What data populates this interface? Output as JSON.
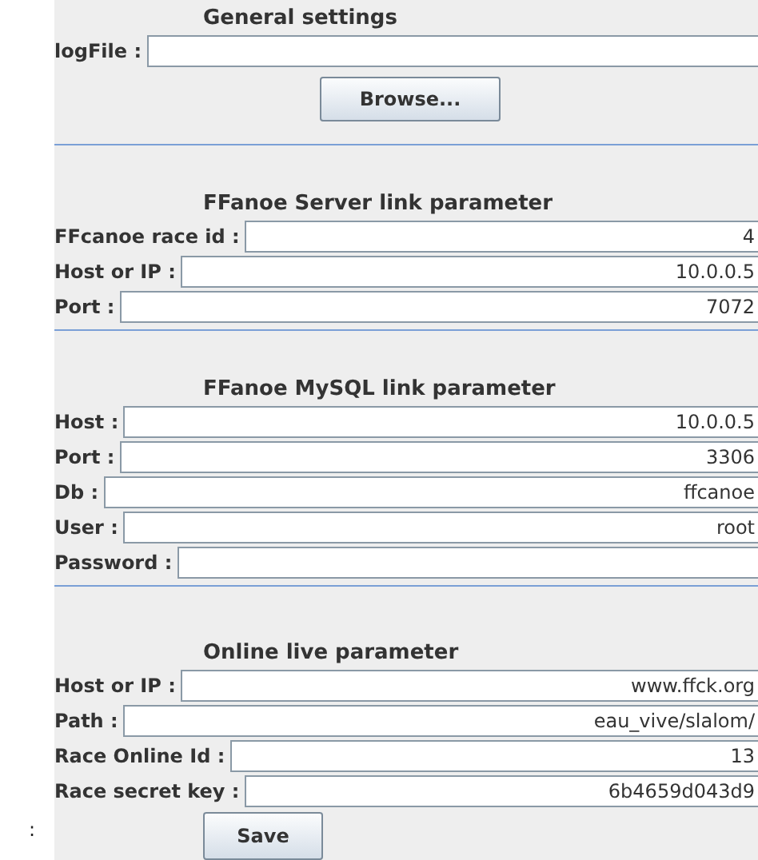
{
  "sections": [
    {
      "title": "General settings",
      "fields": [
        {
          "label": "logFile :"
        }
      ],
      "button": "Browse..."
    },
    {
      "title": "FFanoe Server link parameter",
      "fields": [
        {
          "label": "FFcanoe race id :",
          "value": "4"
        },
        {
          "label": "Host or IP :",
          "value": "10.0.0.5"
        },
        {
          "label": "Port :",
          "value": "7072"
        }
      ]
    },
    {
      "title": "FFanoe MySQL link parameter",
      "fields": [
        {
          "label": "Host :",
          "value": "10.0.0.5"
        },
        {
          "label": "Port :",
          "value": "3306"
        },
        {
          "label": "Db :",
          "value": "ffcanoe"
        },
        {
          "label": "User :",
          "value": "root"
        },
        {
          "label": "Password :"
        }
      ]
    },
    {
      "title": "Online live parameter",
      "fields": [
        {
          "label": "Host or IP :",
          "value": "www.ffck.org"
        },
        {
          "label": "Path :",
          "value": "eau_vive/slalom/"
        },
        {
          "label": "Race Online Id :",
          "value": "13"
        },
        {
          "label": "Race secret key :",
          "value": "6b4659d043d9"
        }
      ],
      "button": "Save"
    }
  ],
  "side_mark": ":"
}
